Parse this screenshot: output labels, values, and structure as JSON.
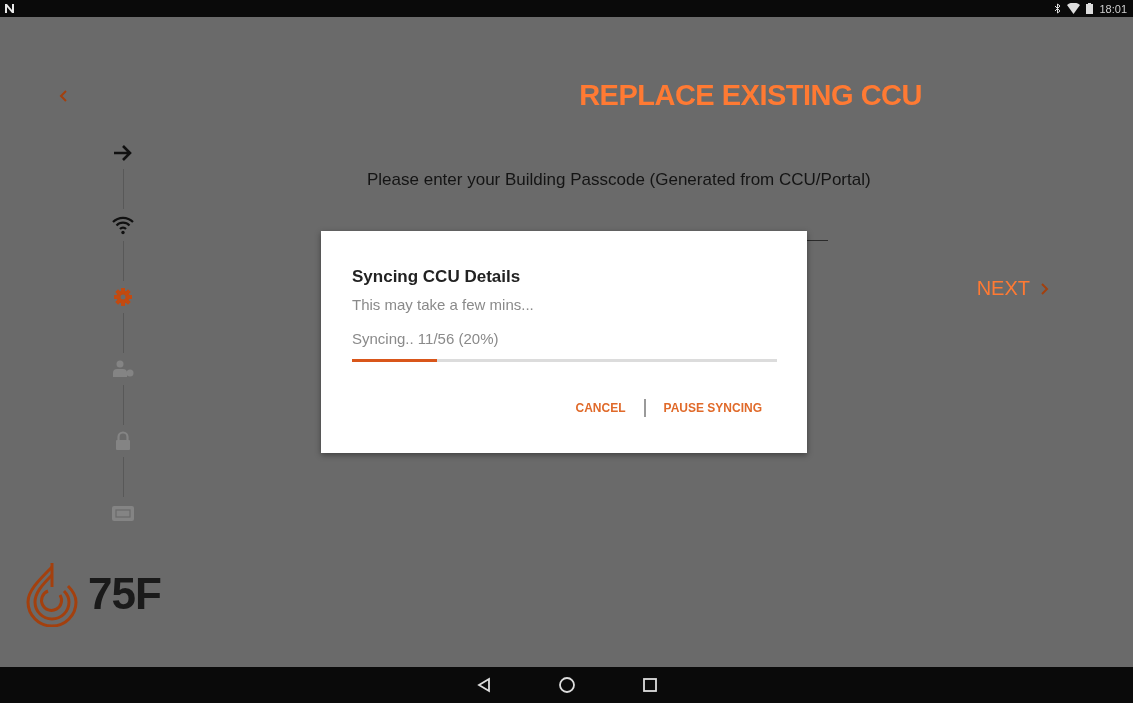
{
  "status_bar": {
    "time": "18:01"
  },
  "header": {
    "title": "REPLACE EXISTING CCU"
  },
  "steps": [
    {
      "kind": "arrow",
      "done": true,
      "selected": false
    },
    {
      "kind": "wifi",
      "done": true,
      "selected": false
    },
    {
      "kind": "gear",
      "done": false,
      "selected": true
    },
    {
      "kind": "user",
      "done": false,
      "selected": false
    },
    {
      "kind": "lock",
      "done": false,
      "selected": false
    },
    {
      "kind": "screen",
      "done": false,
      "selected": false
    }
  ],
  "prompt": "Please enter your Building Passcode (Generated from CCU/Portal)",
  "next_button": {
    "label": "NEXT"
  },
  "logo": {
    "text": "75F"
  },
  "dialog": {
    "title": "Syncing CCU Details",
    "subtitle": "This may take a few mins...",
    "progress_text": "Syncing.. 11/56 (20%)",
    "level": 0.2,
    "buttons": [
      "CANCEL",
      "PAUSE SYNCING"
    ]
  }
}
